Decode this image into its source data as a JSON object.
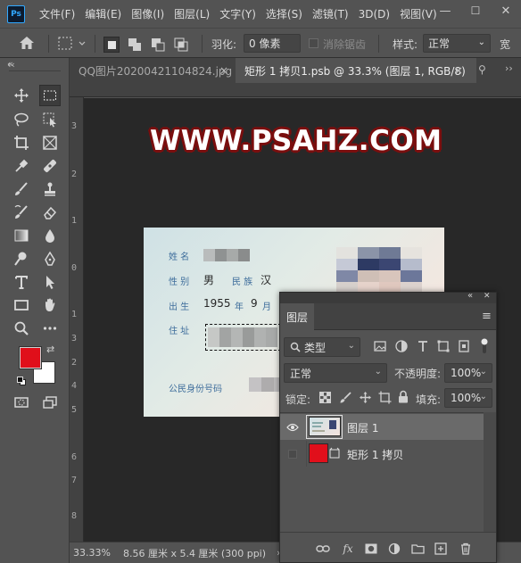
{
  "app": {
    "logo": "Ps"
  },
  "menu": [
    "文件(F)",
    "编辑(E)",
    "图像(I)",
    "图层(L)",
    "文字(Y)",
    "选择(S)",
    "滤镜(T)",
    "3D(D)",
    "视图(V)"
  ],
  "window_controls": {
    "minimize": "—",
    "maximize": "☐",
    "close": "✕"
  },
  "options": {
    "feather_label": "羽化:",
    "feather_value": "0 像素",
    "antialias_label": "消除锯齿",
    "style_label": "样式:",
    "style_value": "正常",
    "width_label": "宽"
  },
  "tabs": [
    {
      "label": "QQ图片20200421104824.jpg",
      "close": "×"
    },
    {
      "label": "矩形 1 拷贝1.psb @ 33.3% (图层 1, RGB/8)",
      "close": "×"
    }
  ],
  "tabbar_collapse": "«",
  "ruler_left_numbers": [
    "3",
    "2",
    "1",
    "0",
    "1",
    "2",
    "3",
    "4",
    "5",
    "6",
    "7",
    "8"
  ],
  "canvas": {
    "watermark": "WWW.PSAHZ.COM",
    "idcard": {
      "name_label": "姓 名",
      "gender_label": "性 别",
      "gender_value": "男",
      "ethnic_label": "民 族",
      "ethnic_value": "汉",
      "birth_label": "出 生",
      "birth_year": "1955",
      "birth_year_unit": "年",
      "birth_month": "9",
      "birth_month_unit": "月",
      "address_label": "住 址",
      "id_label": "公民身份号码"
    }
  },
  "colors": {
    "foreground": "#e00f1a",
    "background": "#ffffff",
    "accent": "#31a8ff",
    "watermark_stroke": "#7a0e0e",
    "red_layer": "#e10f1b"
  },
  "status": {
    "zoom": "33.33%",
    "doc_info": "8.56 厘米 x 5.4 厘米 (300 ppi)",
    "arrow": "›"
  },
  "layers_panel": {
    "collapse": "«",
    "close": "✕",
    "tab_label": "图层",
    "filter_value": "类型",
    "blend_mode": "正常",
    "opacity_label": "不透明度:",
    "opacity_value": "100%",
    "lock_label": "锁定:",
    "fill_label": "填充:",
    "fill_value": "100%",
    "layers": [
      {
        "name": "图层 1",
        "visible": true,
        "selected": true
      },
      {
        "name": "矩形 1 拷贝",
        "visible": false,
        "selected": false
      }
    ]
  }
}
